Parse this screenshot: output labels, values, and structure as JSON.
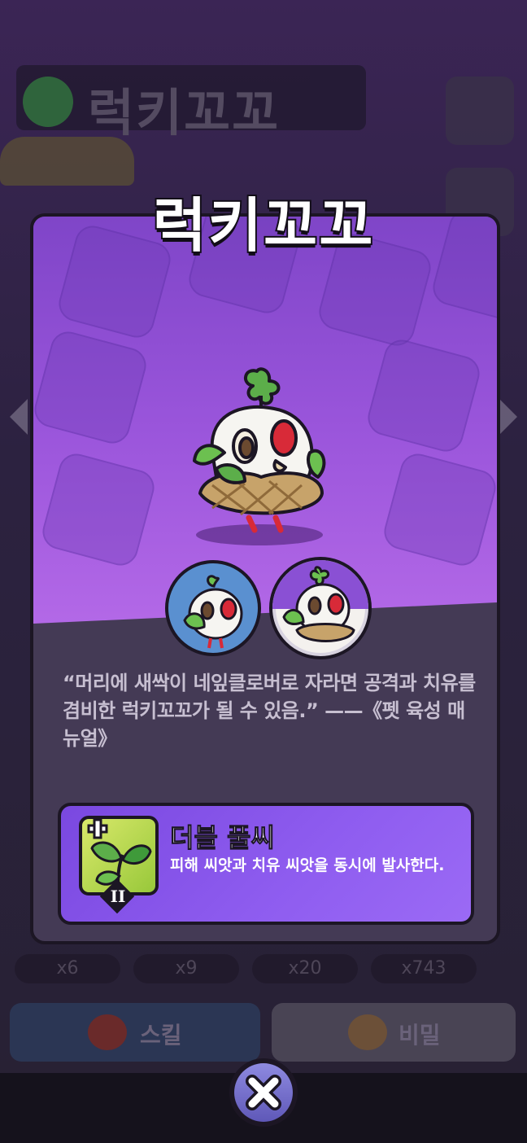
{
  "background": {
    "title": "럭키꼬꼬",
    "pills": [
      "x6",
      "x9",
      "x20",
      "x743"
    ],
    "buttons": [
      {
        "label": "스킬"
      },
      {
        "label": "비밀"
      }
    ]
  },
  "card": {
    "title": "럭키꼬꼬",
    "description": "“머리에 새싹이 네잎클로버로 자라면 공격과 치유를 겸비한 럭키꼬꼬가 될 수 있음.” ——《펫 육성 매뉴얼》",
    "skill": {
      "name": "더블 풀씨",
      "description": "피해 씨앗과 치유 씨앗을 동시에 발사한다.",
      "level_badge": "II",
      "icon": "sprout-heal-icon"
    }
  },
  "close": {
    "icon": "close-icon"
  },
  "colors": {
    "card_art": "#9a55db",
    "card_body": "#443a55",
    "skill_panel": "#8f5df0",
    "close_button": "#7570d0"
  }
}
